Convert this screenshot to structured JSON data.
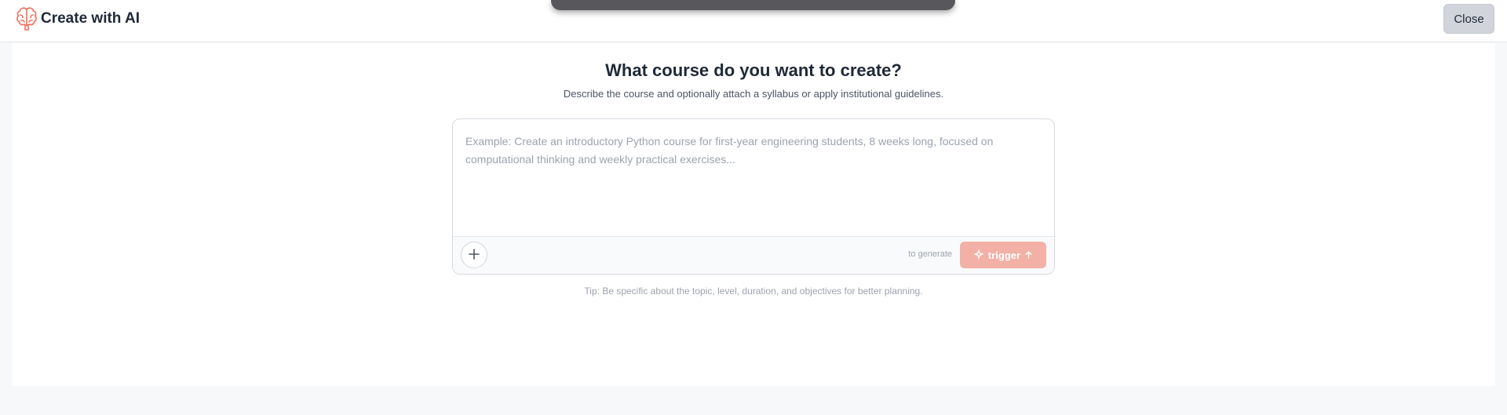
{
  "header": {
    "title": "Create with AI",
    "close_label": "Close",
    "icon": "brain-icon"
  },
  "main": {
    "heading": "What course do you want to create?",
    "subheading": "Describe the course and optionally attach a syllabus or apply institutional guidelines.",
    "prompt": {
      "value": "",
      "placeholder": "Example: Create an introductory Python course for first-year engineering students, 8 weeks long, focused on computational thinking and weekly practical exercises..."
    },
    "hint": "to generate",
    "trigger_label": "trigger",
    "tip": "Tip: Be specific about the topic, level, duration, and objectives for better planning."
  },
  "icons": {
    "attach": "plus-icon",
    "trigger": "sparkle-icon",
    "trigger_suffix": "arrow-up-icon"
  },
  "colors": {
    "accent": "#f3b0a6",
    "brand_icon": "#ef6f5a"
  }
}
